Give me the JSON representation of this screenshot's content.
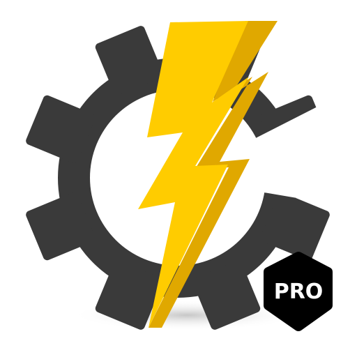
{
  "icon": {
    "badge": {
      "label": "PRO",
      "background_color": "#000000",
      "text_color": "#ffffff"
    },
    "colors": {
      "gear": "#3a3a3a",
      "bolt_front": "#ffcc00",
      "bolt_side": "#e0a800",
      "shadow": "#d9d9d9"
    },
    "icon_names": [
      "gear-icon",
      "lightning-bolt-icon",
      "pro-badge"
    ]
  }
}
